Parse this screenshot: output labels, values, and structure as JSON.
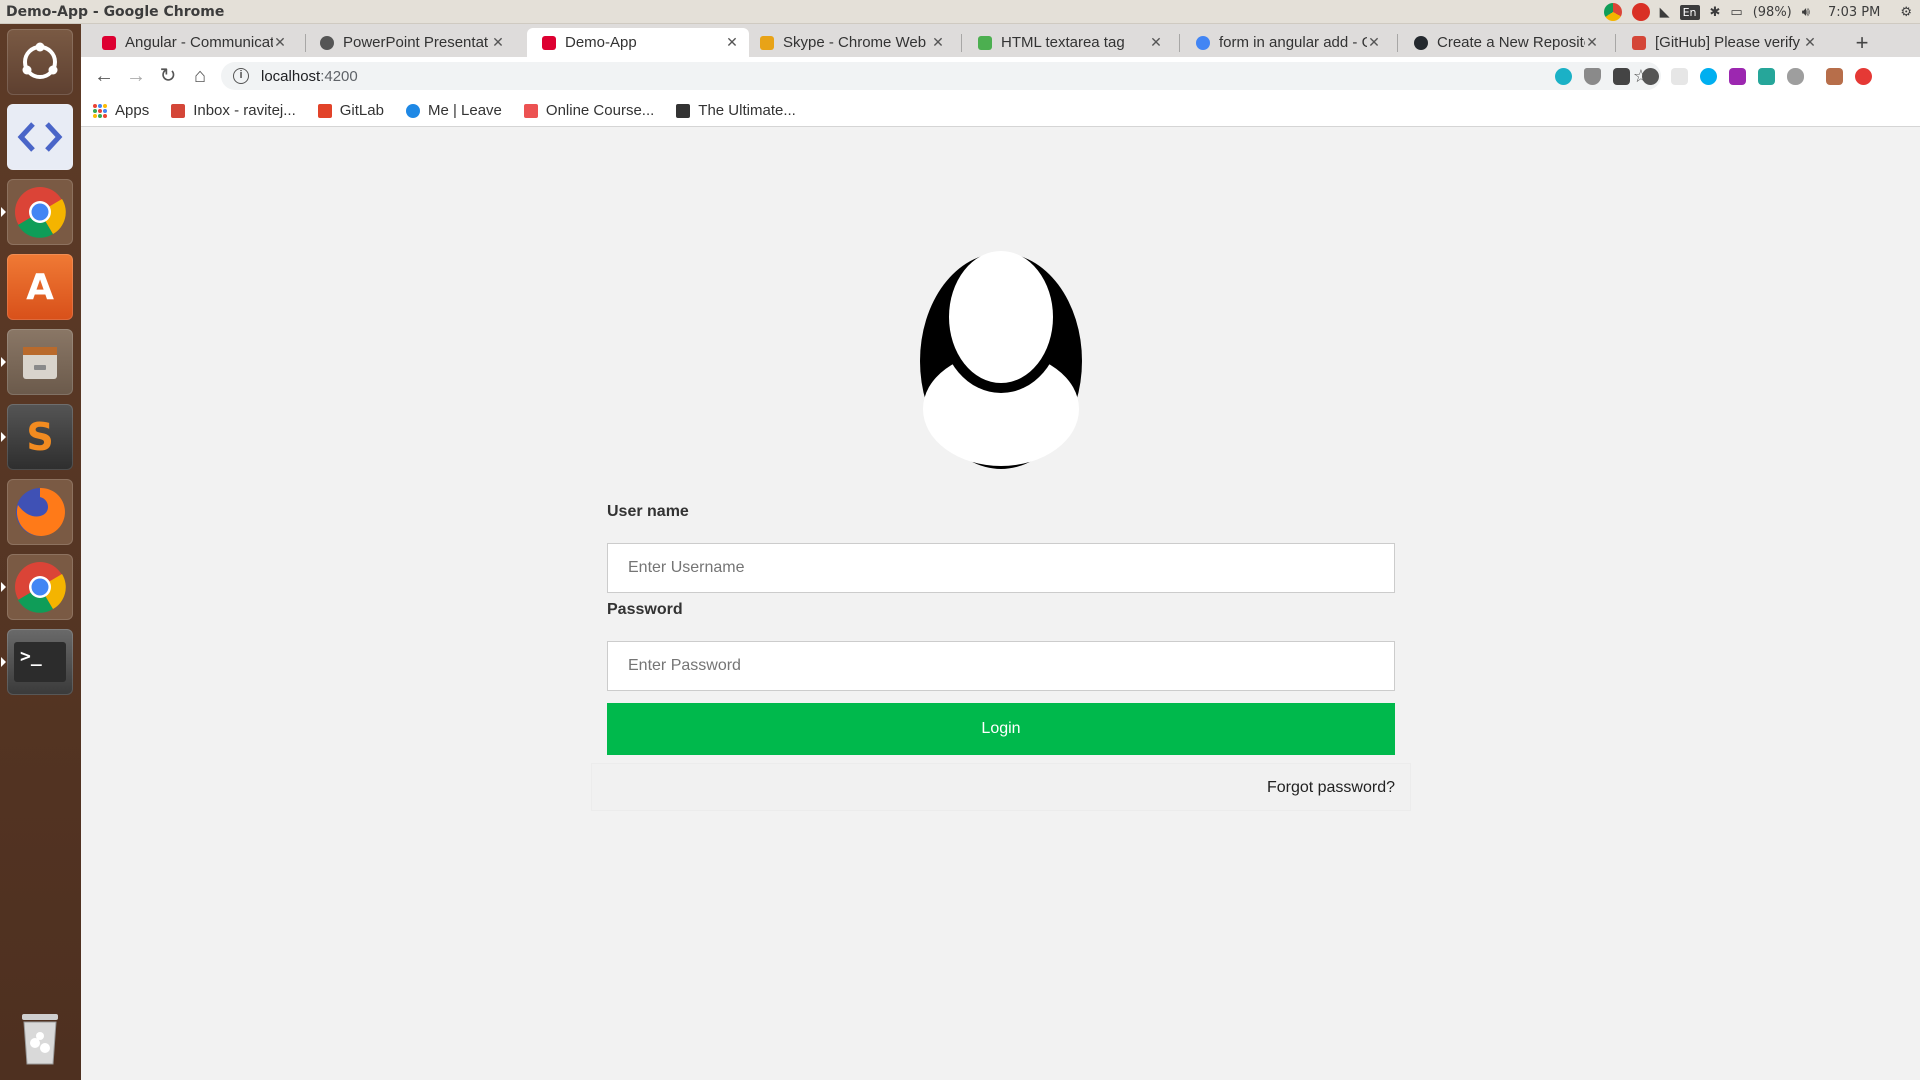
{
  "os": {
    "window_title": "Demo-App - Google Chrome",
    "battery": "(98%)",
    "clock": "7:03 PM",
    "keyboard_layout": "En"
  },
  "launcher": {
    "apps": [
      {
        "name": "ubuntu-dash-icon",
        "color": "#d95f1b"
      },
      {
        "name": "code-editor-icon",
        "color": "#3b5fbf"
      },
      {
        "name": "chrome-icon",
        "color": "#4285f4"
      },
      {
        "name": "software-center-icon",
        "color": "#e05a24"
      },
      {
        "name": "files-icon",
        "color": "#9a8a78"
      },
      {
        "name": "sublime-text-icon",
        "color": "#f28b20"
      },
      {
        "name": "firefox-icon",
        "color": "#e66000"
      },
      {
        "name": "chrome-icon",
        "color": "#4285f4"
      },
      {
        "name": "terminal-icon",
        "color": "#2c2c2c"
      },
      {
        "name": "trash-icon",
        "color": "#bdbdbd"
      }
    ]
  },
  "tabs": [
    {
      "title": "Angular - Communicat",
      "favicon_color": "#dd0031",
      "active": false
    },
    {
      "title": "PowerPoint Presentat",
      "favicon_color": "#555555",
      "active": false
    },
    {
      "title": "Demo-App",
      "favicon_color": "#dd0031",
      "active": true
    },
    {
      "title": "Skype - Chrome Web St",
      "favicon_color": "#e8a317",
      "active": false
    },
    {
      "title": "HTML textarea tag",
      "favicon_color": "#4caf50",
      "active": false
    },
    {
      "title": "form in angular add - G",
      "favicon_color": "#4285f4",
      "active": false
    },
    {
      "title": "Create a New Reposito",
      "favicon_color": "#24292e",
      "active": false
    },
    {
      "title": "[GitHub] Please verify",
      "favicon_color": "#d44638",
      "active": false
    }
  ],
  "address_bar": {
    "host": "localhost",
    "port": ":4200"
  },
  "bookmarks": [
    {
      "label": "Apps",
      "color": "#4285f4"
    },
    {
      "label": "Inbox - ravitej...",
      "color": "#d44638"
    },
    {
      "label": "GitLab",
      "color": "#e24329"
    },
    {
      "label": "Me | Leave",
      "color": "#1e88e5"
    },
    {
      "label": "Online Course...",
      "color": "#ec5252"
    },
    {
      "label": "The Ultimate...",
      "color": "#333333"
    }
  ],
  "login": {
    "username_label": "User name",
    "username_placeholder": "Enter Username",
    "password_label": "Password",
    "password_placeholder": "Enter Password",
    "submit_label": "Login",
    "forgot_link": "Forgot password?",
    "accent_color": "#00b94c"
  }
}
